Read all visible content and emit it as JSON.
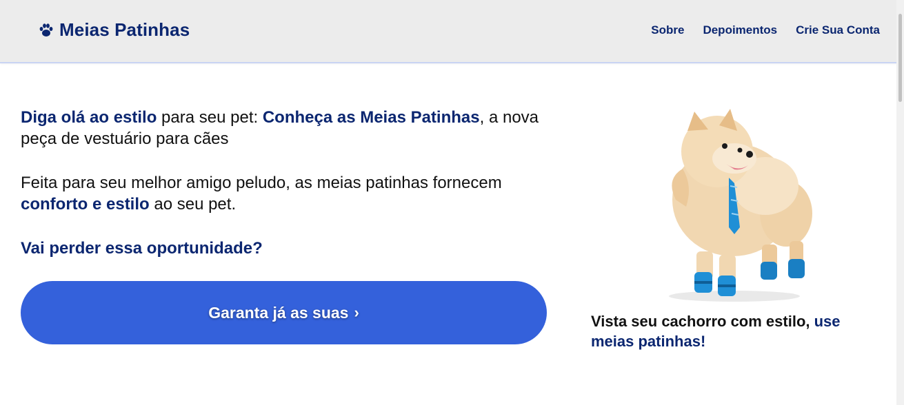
{
  "header": {
    "brand_name": "Meias Patinhas",
    "brand_icon": "paw-icon",
    "nav": [
      {
        "label": "Sobre"
      },
      {
        "label": "Depoimentos"
      },
      {
        "label": "Crie Sua Conta"
      }
    ]
  },
  "hero": {
    "p1": {
      "hl1": "Diga olá ao estilo",
      "t1": " para seu pet: ",
      "hl2": "Conheça as Meias Patinhas",
      "t2": ", a nova peça de vestuário para cães"
    },
    "p2": {
      "t1": "Feita para seu melhor amigo peludo, as meias patinhas fornecem ",
      "hl1": "conforto e estilo",
      "t2": " ao seu pet."
    },
    "question": "Vai perder essa oportunidade?",
    "cta_label": "Garanta já as suas",
    "cta_chevron": "›"
  },
  "figure": {
    "caption_text": "Vista seu cachorro com estilo, ",
    "caption_highlight": "use meias patinhas!"
  },
  "colors": {
    "brand_navy": "#0b2670",
    "cta_blue": "#3461db",
    "header_bg": "#ececec",
    "sock_blue": "#1f8fd6"
  }
}
